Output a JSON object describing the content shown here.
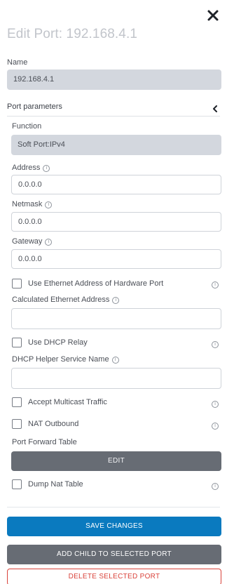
{
  "dialog": {
    "title": "Edit Port: 192.168.4.1",
    "name_label": "Name",
    "name_value": "192.168.4.1"
  },
  "port_parameters": {
    "section_label": "Port parameters",
    "function_label": "Function",
    "function_value": "Soft Port:IPv4",
    "address_label": "Address",
    "address_value": "0.0.0.0",
    "netmask_label": "Netmask",
    "netmask_value": "0.0.0.0",
    "gateway_label": "Gateway",
    "gateway_value": "0.0.0.0",
    "use_ethernet_label": "Use Ethernet Address of Hardware Port",
    "calc_ethernet_label": "Calculated Ethernet Address",
    "calc_ethernet_value": "",
    "use_dhcp_relay_label": "Use DHCP Relay",
    "dhcp_helper_label": "DHCP Helper Service Name",
    "dhcp_helper_value": "",
    "accept_multicast_label": "Accept Multicast Traffic",
    "nat_outbound_label": "NAT Outbound",
    "port_forward_label": "Port Forward Table",
    "edit_button": "EDIT",
    "dump_nat_label": "Dump Nat Table"
  },
  "actions": {
    "save": "SAVE CHANGES",
    "add_child": "ADD CHILD TO SELECTED PORT",
    "delete": "DELETE SELECTED PORT"
  },
  "colors": {
    "primary": "#0a7abf",
    "secondary": "#676c74",
    "danger": "#d9423a",
    "disabled_field": "#d3d7de"
  },
  "icons": {
    "close": "close-icon",
    "collapse": "chevron-left-icon",
    "info": "info-icon"
  }
}
